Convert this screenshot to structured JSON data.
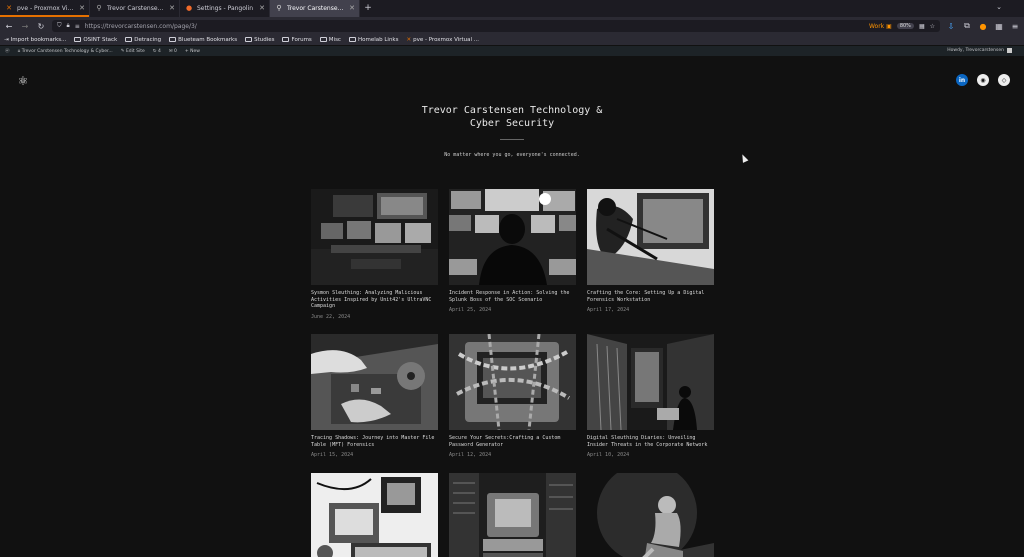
{
  "browser": {
    "tabs": [
      {
        "title": "pve - Proxmox Virtual Envir...",
        "active": false,
        "accent": "#e57000"
      },
      {
        "title": "Trevor Carstensen Technolo...",
        "active": false,
        "accent": "#777777"
      },
      {
        "title": "Settings - Pangolin",
        "active": false,
        "accent": "#f26b2a"
      },
      {
        "title": "Trevor Carstensen Technolo...",
        "active": true,
        "accent": "#00ddff"
      }
    ],
    "new_tab": "+",
    "url": "https://trevorcarstensen.com/page/3/",
    "container_label": "Work",
    "zoom": "80%",
    "bookmarks": [
      {
        "label": "Import bookmarks...",
        "kind": "bookmark"
      },
      {
        "label": "OSINT Stack",
        "kind": "folder"
      },
      {
        "label": "Detracing",
        "kind": "folder"
      },
      {
        "label": "Blueteam Bookmarks",
        "kind": "folder"
      },
      {
        "label": "Studies",
        "kind": "folder"
      },
      {
        "label": "Forums",
        "kind": "folder"
      },
      {
        "label": "Misc",
        "kind": "folder"
      },
      {
        "label": "Homelab Links",
        "kind": "folder"
      },
      {
        "label": "pve - Proxmox Virtual ...",
        "kind": "bookmark"
      }
    ]
  },
  "wp_admin": {
    "site_link": "Trevor Carstensen Technology & Cyber...",
    "edit_site": "Edit Site",
    "updates": "4",
    "comments": "0",
    "new": "New",
    "howdy": "Howdy, Trevorcarstensen"
  },
  "site": {
    "title_line1": "Trevor Carstensen Technology &",
    "title_line2": "Cyber Security",
    "tagline": "No matter where you go, everyone's connected."
  },
  "posts": [
    {
      "title": "Sysmon Sleuthing: Analyzing Malicious Activities Inspired by Unit42's UltraVNC Campaign",
      "date": "June 22, 2024",
      "icon": "control-room-image"
    },
    {
      "title": "Incident Response in Action: Solving the Splunk Boss of the SOC Scenario",
      "date": "April 25, 2024",
      "icon": "analyst-monitors-image"
    },
    {
      "title": "Crafting the Core: Setting Up a Digital Forensics Workstation",
      "date": "April 17, 2024",
      "icon": "workstation-build-image"
    },
    {
      "title": "Tracing Shadows: Journey into Master File Table (MFT) Forensics",
      "date": "April 15, 2024",
      "icon": "hands-circuit-board-image"
    },
    {
      "title": "Secure Your Secrets:Crafting a Custom Password Generator",
      "date": "April 12, 2024",
      "icon": "chained-computer-image"
    },
    {
      "title": "Digital Sleuthing Diaries: Unveiling Insider Threats in the Corporate Network",
      "date": "April 10, 2024",
      "icon": "server-room-figure-image"
    },
    {
      "title": "",
      "date": "",
      "icon": "retro-machines-image"
    },
    {
      "title": "",
      "date": "",
      "icon": "old-computer-books-image"
    },
    {
      "title": "",
      "date": "",
      "icon": "hooded-figure-image"
    }
  ]
}
